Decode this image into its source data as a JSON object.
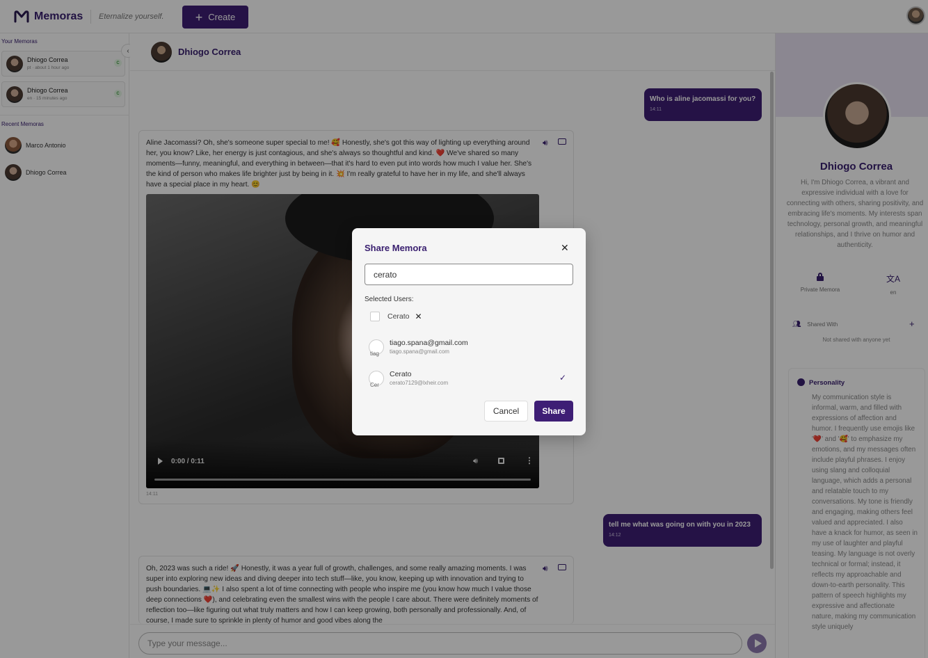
{
  "app": {
    "brand": "Memoras",
    "tagline": "Eternalize yourself.",
    "create_label": "Create"
  },
  "sidebar": {
    "your_heading": "Your Memoras",
    "your_memoras": [
      {
        "name": "Dhiogo Correa",
        "meta": "pt · about 1 hour ago",
        "badge": "C"
      },
      {
        "name": "Dhiogo Correa",
        "meta": "en · 15 minutes ago",
        "badge": "C"
      }
    ],
    "recent_heading": "Recent Memoras",
    "recent": [
      {
        "name": "Marco Antonio"
      },
      {
        "name": "Dhiogo Correa"
      }
    ]
  },
  "chat": {
    "header_name": "Dhiogo Correa",
    "messages": [
      {
        "role": "user",
        "text": "Who is aline jacomassi for you?",
        "time": "14:11"
      },
      {
        "role": "bot",
        "text": "Aline Jacomassi? Oh, she's someone super special to me! 🥰 Honestly, she's got this way of lighting up everything around her, you know? Like, her energy is just contagious, and she's always so thoughtful and kind. ❤️ We've shared so many moments—funny, meaningful, and everything in between—that it's hard to even put into words how much I value her. She's the kind of person who makes life brighter just by being in it. 💥 I'm really grateful to have her in my life, and she'll always have a special place in my heart. 😊",
        "time": "14:11",
        "video_timecode": "0:00 / 0:11"
      },
      {
        "role": "user",
        "text": "tell me what was going on with you in 2023",
        "time": "14:12"
      },
      {
        "role": "bot",
        "text": "Oh, 2023 was such a ride! 🚀 Honestly, it was a year full of growth, challenges, and some really amazing moments. I was super into exploring new ideas and diving deeper into tech stuff—like, you know, keeping up with innovation and trying to push boundaries. 💻✨ I also spent a lot of time connecting with people who inspire me (you know how much I value those deep connections ❤️), and celebrating even the smallest wins with the people I care about. There were definitely moments of reflection too—like figuring out what truly matters and how I can keep growing, both personally and professionally. And, of course, I made sure to sprinkle in plenty of humor and good vibes along the"
      }
    ],
    "input_placeholder": "Type your message..."
  },
  "profile": {
    "name": "Dhiogo Correa",
    "bio": "Hi, I'm Dhiogo Correa, a vibrant and expressive individual with a love for connecting with others, sharing positivity, and embracing life's moments. My interests span technology, personal growth, and meaningful relationships, and I thrive on humor and authenticity.",
    "privacy_label": "Private Memora",
    "language_label": "en",
    "shared_with_label": "Shared With",
    "shared_empty": "Not shared with anyone yet",
    "personality_title": "Personality",
    "personality_text": "My communication style is informal, warm, and filled with expressions of affection and humor. I frequently use emojis like '❤️' and '🥰' to emphasize my emotions, and my messages often include playful phrases. I enjoy using slang and colloquial language, which adds a personal and relatable touch to my conversations. My tone is friendly and engaging, making others feel valued and appreciated. I also have a knack for humor, as seen in my use of laughter and playful teasing. My language is not overly technical or formal; instead, it reflects my approachable and down-to-earth personality. This pattern of speech highlights my expressive and affectionate nature, making my communication style uniquely"
  },
  "modal": {
    "title": "Share Memora",
    "search_value": "cerato",
    "selected_label": "Selected Users:",
    "selected_chip": "Cerato",
    "results": [
      {
        "name": "tiago.spana@gmail.com",
        "email": "tiago.spana@gmail.com",
        "avatar_alt": "tiag",
        "selected": false
      },
      {
        "name": "Cerato",
        "email": "cerato7129@lxheir.com",
        "avatar_alt": "Cer",
        "selected": true
      }
    ],
    "cancel_label": "Cancel",
    "share_label": "Share"
  },
  "colors": {
    "primary": "#3e1e75",
    "primary_text": "#3a2070",
    "overlay": "rgba(0,0,0,0.4)"
  }
}
